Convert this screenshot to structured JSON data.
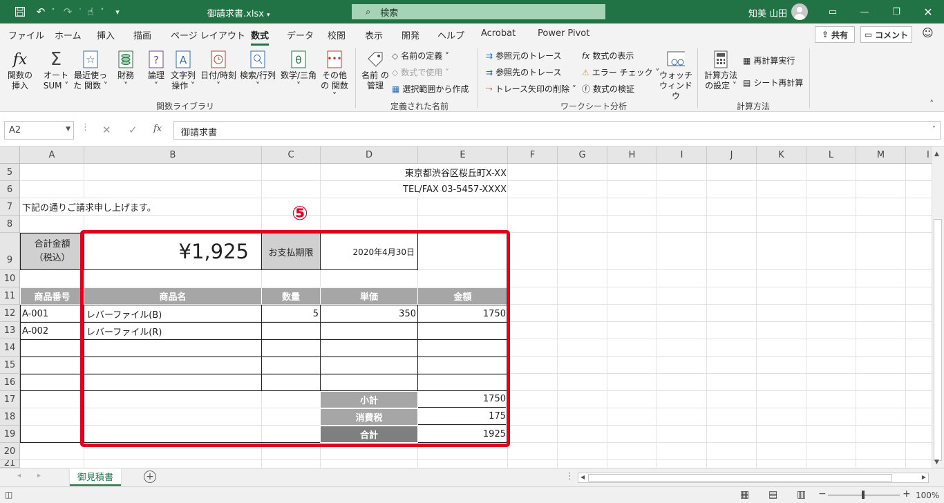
{
  "titlebar": {
    "filename": "御請求書.xlsx",
    "search_placeholder": "検索",
    "user": "知美 山田",
    "accent": "#217346"
  },
  "tabs": [
    "ファイル",
    "ホーム",
    "挿入",
    "描画",
    "ページ レイアウト",
    "数式",
    "データ",
    "校閲",
    "表示",
    "開発",
    "ヘルプ",
    "Acrobat",
    "Power Pivot"
  ],
  "active_tab": "数式",
  "share_label": "共有",
  "comment_label": "コメント",
  "ribbon": {
    "insert_fn": "関数の 挿入",
    "autosum": "オート SUM ˅",
    "recent": "最近使った 関数 ˅",
    "financial": "財務",
    "logical": "論理",
    "text": "文字列 操作 ˅",
    "datetime": "日付/時刻",
    "lookup": "検索/行列",
    "math": "数学/三角",
    "more": "その他の 関数 ˅",
    "group_library": "関数ライブラリ",
    "name_mgr": "名前 の管理",
    "define_name": "名前の定義 ˅",
    "use_in_formula": "数式で使用 ˅",
    "create_from_sel": "選択範囲から作成",
    "group_names": "定義された名前",
    "trace_prec": "参照元のトレース",
    "trace_dep": "参照先のトレース",
    "remove_arrows": "トレース矢印の削除 ˅",
    "show_formulas": "数式の表示",
    "error_check": "エラー チェック ˅",
    "eval_formula": "数式の検証",
    "watch": "ウォッチ ウィンドウ",
    "group_audit": "ワークシート分析",
    "calc_options": "計算方法 の設定 ˅",
    "calc_now": "再計算実行",
    "calc_sheet": "シート再計算",
    "group_calc": "計算方法"
  },
  "namebox": "A2",
  "formula": "御請求書",
  "columns": [
    "A",
    "B",
    "C",
    "D",
    "E",
    "F",
    "G",
    "H",
    "I",
    "J",
    "K",
    "L",
    "M",
    "I"
  ],
  "rows": [
    "5",
    "6",
    "7",
    "8",
    "9",
    "10",
    "11",
    "12",
    "13",
    "14",
    "15",
    "16",
    "17",
    "18",
    "19",
    "20",
    "21"
  ],
  "cells": {
    "address": "東京都渋谷区桜丘町X-XX",
    "telfax": "TEL/FAX 03-5457-XXXX",
    "greeting": "下記の通りご請求申し上げます。",
    "total_label": "合計金額",
    "total_label2": "（税込）",
    "total_value": "¥1,925",
    "due_label": "お支払期限",
    "due_value": "2020年4月30日",
    "h_code": "商品番号",
    "h_name": "商品名",
    "h_qty": "数量",
    "h_price": "単価",
    "h_amount": "金額",
    "r1_code": "A-001",
    "r1_name": "レバーファイル(B)",
    "r1_qty": "5",
    "r1_price": "350",
    "r1_amount": "1750",
    "r2_code": "A-002",
    "r2_name": "レバーファイル(R)",
    "subtotal_label": "小計",
    "subtotal": "1750",
    "tax_label": "消費税",
    "tax": "175",
    "grand_label": "合計",
    "grand": "1925"
  },
  "annotation": "⑤",
  "sheet_tab": "御見積書",
  "zoom": "100%"
}
